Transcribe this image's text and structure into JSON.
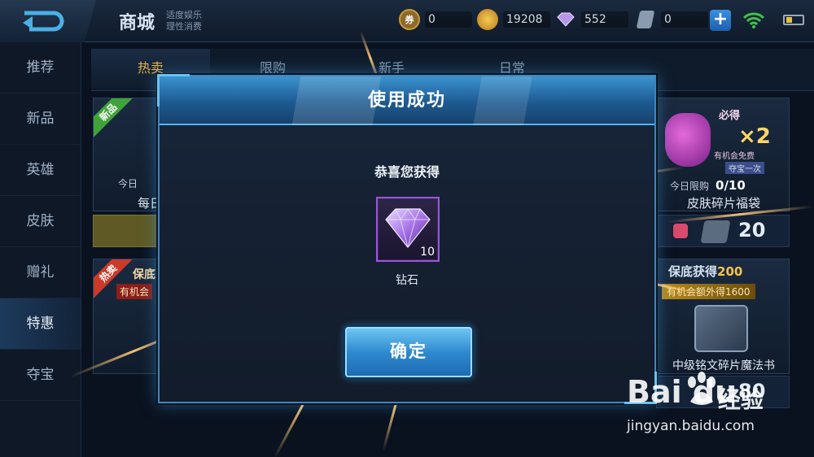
{
  "header": {
    "title": "商城",
    "subtitle_line1": "适度娱乐",
    "subtitle_line2": "理性消费",
    "currencies": [
      {
        "name": "coupon",
        "icon": "coupon-coin-icon",
        "value": "0",
        "color": "#c89a3a"
      },
      {
        "name": "gold",
        "icon": "gold-coin-icon",
        "value": "19208",
        "color": "#e0a22c"
      },
      {
        "name": "diamond",
        "icon": "diamond-icon",
        "value": "552",
        "color": "#b896e6"
      },
      {
        "name": "voucher",
        "icon": "voucher-icon",
        "value": "0",
        "color": "#8a9bb0"
      }
    ],
    "plus_label": "+"
  },
  "tabs": [
    {
      "label": "热卖",
      "active": true
    },
    {
      "label": "限购",
      "active": false
    },
    {
      "label": "新手",
      "active": false
    },
    {
      "label": "日常",
      "active": false
    }
  ],
  "sidebar": {
    "items": [
      {
        "label": "推荐",
        "active": false
      },
      {
        "label": "新品",
        "active": false
      },
      {
        "label": "英雄",
        "active": false
      },
      {
        "label": "皮肤",
        "active": false
      },
      {
        "label": "赠礼",
        "active": false
      },
      {
        "label": "特惠",
        "active": true
      },
      {
        "label": "夺宝",
        "active": false
      }
    ]
  },
  "cards": {
    "left_top": {
      "ribbon": "新品",
      "limit_text": "今日",
      "name_partial": "每日"
    },
    "left_bottom": {
      "ribbon": "热卖",
      "guarantee_partial": "保底获",
      "extra_partial": "有机会"
    },
    "right_top": {
      "must_text": "必得",
      "multiplier": "×2",
      "chance_text": "有机会免费",
      "limit_once": "夺宝一次",
      "limit_label": "今日限购",
      "limit_value": "0/10",
      "title": "皮肤碎片福袋",
      "price": "20"
    },
    "right_bottom": {
      "guarantee_prefix": "保底获得",
      "guarantee_value": "200",
      "extra_text": "有机会额外得1600",
      "title": "中级铭文碎片魔法书",
      "price": "80"
    }
  },
  "dialog": {
    "title": "使用成功",
    "message": "恭喜您获得",
    "item": {
      "name": "钻石",
      "count": "10",
      "icon": "diamond-icon",
      "border_color": "#9b54d8"
    },
    "confirm_label": "确定"
  },
  "watermark": {
    "logo_text": "Bai du",
    "logo_suffix": "经验",
    "url": "jingyan.baidu.com"
  },
  "colors": {
    "accent_blue": "#3f86c0",
    "tab_active": "#e5b44a",
    "ray_orange": "#ffb060"
  }
}
